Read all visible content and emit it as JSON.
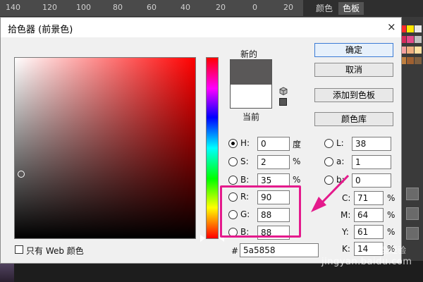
{
  "ruler": {
    "ticks": [
      "140",
      "120",
      "100",
      "80",
      "60",
      "40",
      "20",
      "0",
      "20"
    ]
  },
  "panel": {
    "tab_color": "颜色",
    "tab_swatches": "色板"
  },
  "dialog": {
    "title": "拾色器 (前景色)",
    "close": "×",
    "new_label": "新的",
    "current_label": "当前",
    "new_color": "#5a5858",
    "current_color": "#ffffff",
    "buttons": {
      "ok": "确定",
      "cancel": "取消",
      "add_swatch": "添加到色板",
      "color_library": "颜色库"
    },
    "hsb": [
      {
        "label": "H:",
        "value": "0",
        "unit": "度",
        "selected": true
      },
      {
        "label": "S:",
        "value": "2",
        "unit": "%",
        "selected": false
      },
      {
        "label": "B:",
        "value": "35",
        "unit": "%",
        "selected": false
      }
    ],
    "rgb": [
      {
        "label": "R:",
        "value": "90"
      },
      {
        "label": "G:",
        "value": "88"
      },
      {
        "label": "B:",
        "value": "88"
      }
    ],
    "lab": [
      {
        "label": "L:",
        "value": "38"
      },
      {
        "label": "a:",
        "value": "1"
      },
      {
        "label": "b:",
        "value": "0"
      }
    ],
    "cmyk": [
      {
        "label": "C:",
        "value": "71",
        "unit": "%"
      },
      {
        "label": "M:",
        "value": "64",
        "unit": "%"
      },
      {
        "label": "Y:",
        "value": "61",
        "unit": "%"
      },
      {
        "label": "K:",
        "value": "14",
        "unit": "%"
      }
    ],
    "web_only_label": "只有 Web 颜色",
    "hex_prefix": "#",
    "hex_value": "5a5858"
  },
  "colors": {
    "highlight": "#e41a8c",
    "arrow": "#e41a8c"
  },
  "watermark": {
    "site": "jingyan.baidu.com",
    "brand": "百度经验"
  }
}
